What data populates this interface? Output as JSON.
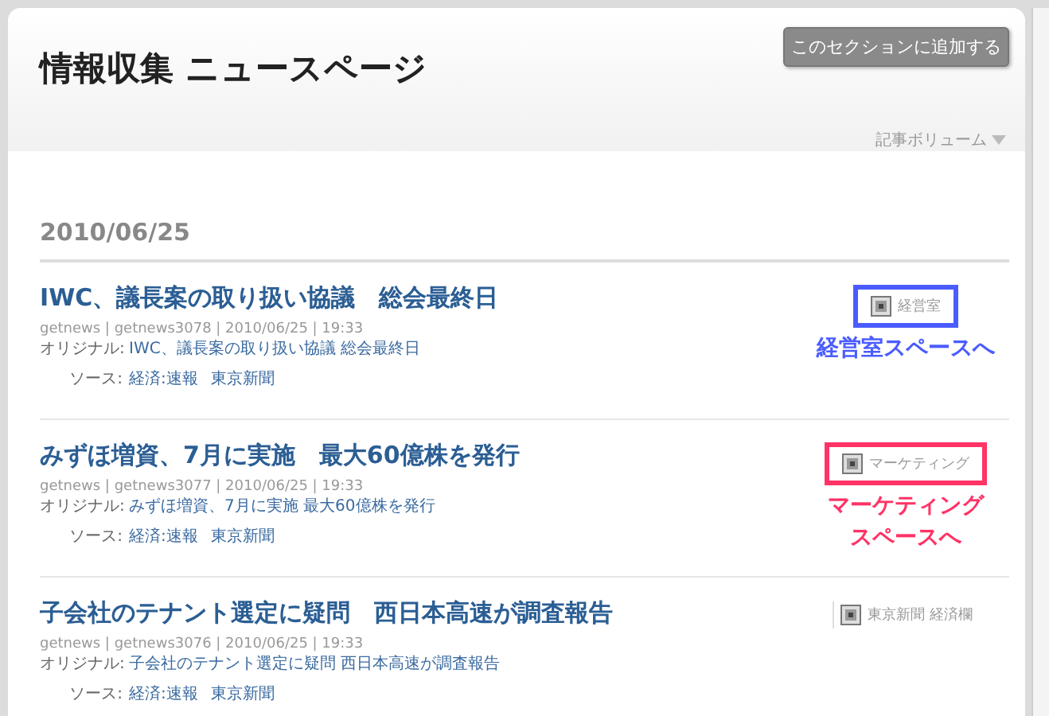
{
  "page": {
    "title": "情報収集 ニュースページ",
    "add_button": "このセクションに追加する",
    "volume_menu": "記事ボリューム"
  },
  "date": "2010/06/25",
  "articles": [
    {
      "title": "IWC、議長案の取り扱い協議　総会最終日",
      "meta": "getnews | getnews3078 | 2010/06/25 | 19:33",
      "original_label": "オリジナル:",
      "original": "IWC、議長案の取り扱い協議  総会最終日",
      "source_label": "ソース:",
      "sources": [
        "経済:速報",
        "東京新聞"
      ],
      "tag": {
        "label": "経営室",
        "kind": "boxed",
        "color": "#4a5cff",
        "callout": [
          "経営室スペースへ"
        ]
      }
    },
    {
      "title": "みずほ増資、7月に実施　最大60億株を発行",
      "meta": "getnews | getnews3077 | 2010/06/25 | 19:33",
      "original_label": "オリジナル:",
      "original": "みずほ増資、7月に実施  最大60億株を発行",
      "source_label": "ソース:",
      "sources": [
        "経済:速報",
        "東京新聞"
      ],
      "tag": {
        "label": "マーケティング",
        "kind": "boxed",
        "color": "#ff3366",
        "callout": [
          "マーケティング",
          "スペースへ"
        ]
      }
    },
    {
      "title": "子会社のテナント選定に疑問　西日本高速が調査報告",
      "meta": "getnews | getnews3076 | 2010/06/25 | 19:33",
      "original_label": "オリジナル:",
      "original": "子会社のテナント選定に疑問  西日本高速が調査報告",
      "source_label": "ソース:",
      "sources": [
        "経済:速報",
        "東京新聞"
      ],
      "tag": {
        "label": "東京新聞 経済欄",
        "kind": "plain"
      }
    }
  ]
}
